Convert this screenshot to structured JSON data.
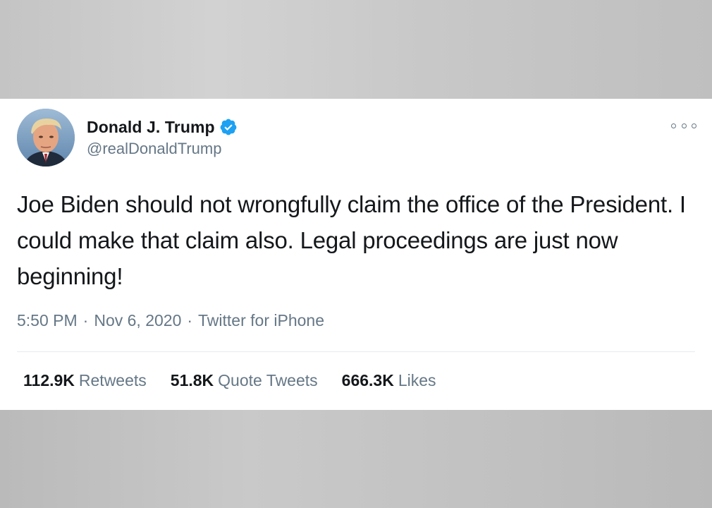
{
  "tweet": {
    "author": {
      "display_name": "Donald J. Trump",
      "handle": "@realDonaldTrump",
      "verified": true
    },
    "text": "Joe Biden should not wrongfully claim the office of the President. I could make that claim also. Legal proceedings are just now beginning!",
    "time": "5:50 PM",
    "separator": "·",
    "date": "Nov 6, 2020",
    "source": "Twitter for iPhone",
    "stats": {
      "retweets_count": "112.9K",
      "retweets_label": "Retweets",
      "quotes_count": "51.8K",
      "quotes_label": "Quote Tweets",
      "likes_count": "666.3K",
      "likes_label": "Likes"
    }
  },
  "icons": {
    "verified": "verified-badge-icon",
    "more": "more-options-icon"
  },
  "colors": {
    "text_primary": "#14171a",
    "text_secondary": "#657786",
    "verified_blue": "#1da1f2",
    "background_outer": "#c6c6c6",
    "card": "#ffffff"
  }
}
